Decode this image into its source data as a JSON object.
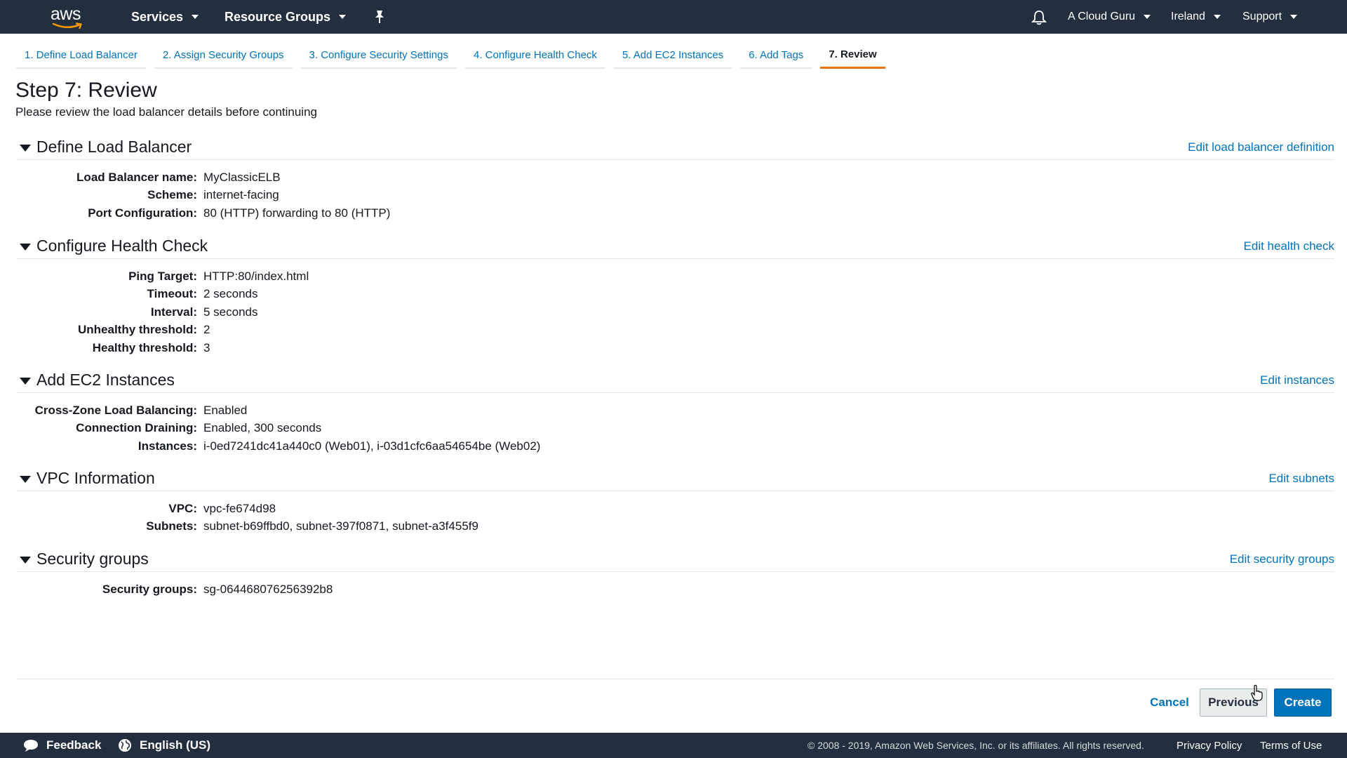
{
  "topnav": {
    "logo": "aws",
    "services": "Services",
    "resource_groups": "Resource Groups",
    "account": "A Cloud Guru",
    "region": "Ireland",
    "support": "Support"
  },
  "tabs": [
    {
      "label": "1. Define Load Balancer"
    },
    {
      "label": "2. Assign Security Groups"
    },
    {
      "label": "3. Configure Security Settings"
    },
    {
      "label": "4. Configure Health Check"
    },
    {
      "label": "5. Add EC2 Instances"
    },
    {
      "label": "6. Add Tags"
    },
    {
      "label": "7. Review"
    }
  ],
  "page": {
    "title": "Step 7: Review",
    "subtitle": "Please review the load balancer details before continuing"
  },
  "sections": {
    "define": {
      "title": "Define Load Balancer",
      "edit": "Edit load balancer definition",
      "rows": [
        {
          "label": "Load Balancer name:",
          "value": "MyClassicELB"
        },
        {
          "label": "Scheme:",
          "value": "internet-facing"
        },
        {
          "label": "Port Configuration:",
          "value": "80 (HTTP) forwarding to 80 (HTTP)"
        }
      ]
    },
    "health": {
      "title": "Configure Health Check",
      "edit": "Edit health check",
      "rows": [
        {
          "label": "Ping Target:",
          "value": "HTTP:80/index.html"
        },
        {
          "label": "Timeout:",
          "value": "2 seconds"
        },
        {
          "label": "Interval:",
          "value": "5 seconds"
        },
        {
          "label": "Unhealthy threshold:",
          "value": "2"
        },
        {
          "label": "Healthy threshold:",
          "value": "3"
        }
      ]
    },
    "ec2": {
      "title": "Add EC2 Instances",
      "edit": "Edit instances",
      "rows": [
        {
          "label": "Cross-Zone Load Balancing:",
          "value": "Enabled"
        },
        {
          "label": "Connection Draining:",
          "value": "Enabled, 300 seconds"
        },
        {
          "label": "Instances:",
          "value": "i-0ed7241dc41a440c0 (Web01), i-03d1cfc6aa54654be (Web02)"
        }
      ]
    },
    "vpc": {
      "title": "VPC Information",
      "edit": "Edit subnets",
      "rows": [
        {
          "label": "VPC:",
          "value": "vpc-fe674d98"
        },
        {
          "label": "Subnets:",
          "value": "subnet-b69ffbd0, subnet-397f0871, subnet-a3f455f9"
        }
      ]
    },
    "sg": {
      "title": "Security groups",
      "edit": "Edit security groups",
      "rows": [
        {
          "label": "Security groups:",
          "value": "sg-064468076256392b8"
        }
      ]
    }
  },
  "actions": {
    "cancel": "Cancel",
    "previous": "Previous",
    "create": "Create"
  },
  "footer": {
    "feedback": "Feedback",
    "language": "English (US)",
    "copyright": "© 2008 - 2019, Amazon Web Services, Inc. or its affiliates. All rights reserved.",
    "privacy": "Privacy Policy",
    "terms": "Terms of Use"
  },
  "colors": {
    "nav_bg": "#232f3e",
    "link": "#0073bb",
    "active_tab": "#ec7211",
    "primary_button": "#0073bb"
  }
}
